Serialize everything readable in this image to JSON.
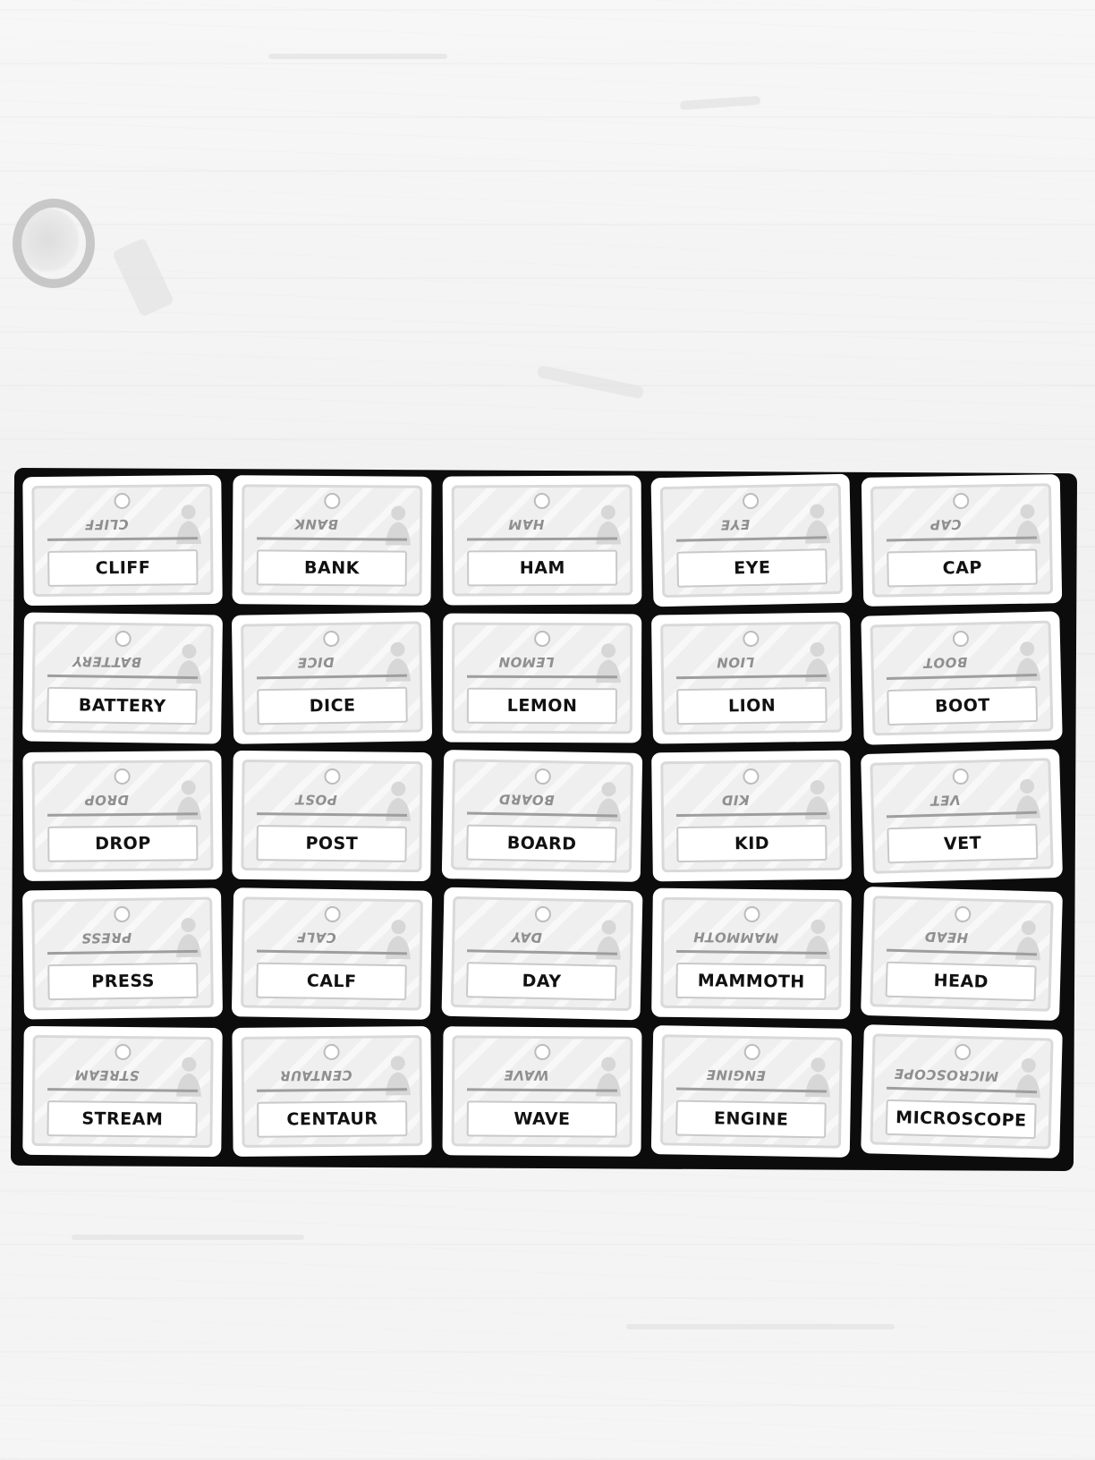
{
  "game": {
    "grid_rows": 5,
    "grid_columns": 5,
    "cards": [
      {
        "word": "CLIFF"
      },
      {
        "word": "BANK"
      },
      {
        "word": "HAM"
      },
      {
        "word": "EYE"
      },
      {
        "word": "CAP"
      },
      {
        "word": "BATTERY"
      },
      {
        "word": "DICE"
      },
      {
        "word": "LEMON"
      },
      {
        "word": "LION"
      },
      {
        "word": "BOOT"
      },
      {
        "word": "DROP"
      },
      {
        "word": "POST"
      },
      {
        "word": "BOARD"
      },
      {
        "word": "KID"
      },
      {
        "word": "VET"
      },
      {
        "word": "PRESS"
      },
      {
        "word": "CALF"
      },
      {
        "word": "DAY"
      },
      {
        "word": "MAMMOTH"
      },
      {
        "word": "HEAD"
      },
      {
        "word": "STREAM"
      },
      {
        "word": "CENTAUR"
      },
      {
        "word": "WAVE"
      },
      {
        "word": "ENGINE"
      },
      {
        "word": "MICROSCOPE"
      }
    ]
  },
  "colors": {
    "board": "#0c0c0c",
    "card": "#ffffff",
    "card_inner": "#efefef",
    "word_text": "#111111",
    "mirror_text": "#8f8f8f",
    "table": "#f4f4f4"
  },
  "icons": {
    "card_hole": "hole-icon",
    "card_art": "agent-silhouette-icon"
  }
}
